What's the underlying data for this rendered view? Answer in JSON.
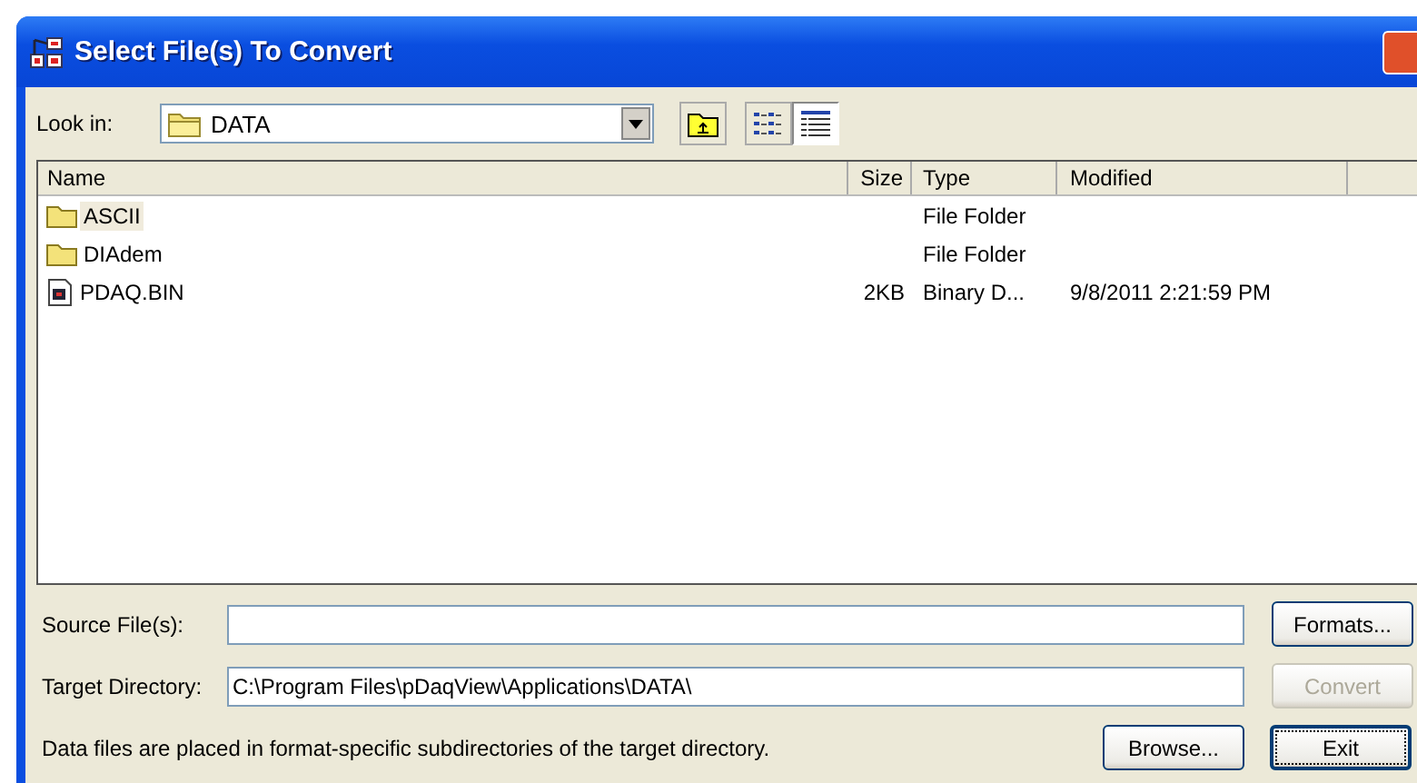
{
  "window": {
    "title": "Select File(s) To Convert"
  },
  "look_in": {
    "label": "Look in:",
    "value": "DATA"
  },
  "view_modes": [
    {
      "kind": "list",
      "selected": false
    },
    {
      "kind": "details",
      "selected": true
    }
  ],
  "table": {
    "columns": [
      "Name",
      "Size",
      "Type",
      "Modified"
    ],
    "rows": [
      {
        "kind": "folder",
        "name": "ASCII",
        "type": "File Folder",
        "selected": true
      },
      {
        "kind": "folder",
        "name": "DIAdem",
        "type": "File Folder",
        "selected": false
      },
      {
        "kind": "file",
        "name": "PDAQ.BIN",
        "size": "2KB",
        "type": "Binary D...",
        "modified": "9/8/2011 2:21:59 PM",
        "selected": false
      }
    ]
  },
  "fields": [
    {
      "label": "Source File(s):"
    },
    {
      "label": "Target Directory:",
      "value": "C:\\Program Files\\pDaqView\\Applications\\DATA\\"
    }
  ],
  "note": "Data files are placed in format-specific subdirectories of the target directory.",
  "buttons": [
    {
      "label": "Formats...",
      "disabled": false,
      "default": false
    },
    {
      "label": "Convert",
      "disabled": true,
      "default": false
    },
    {
      "label": "Browse...",
      "disabled": false,
      "default": false
    },
    {
      "label": "Exit",
      "disabled": false,
      "default": true
    }
  ]
}
